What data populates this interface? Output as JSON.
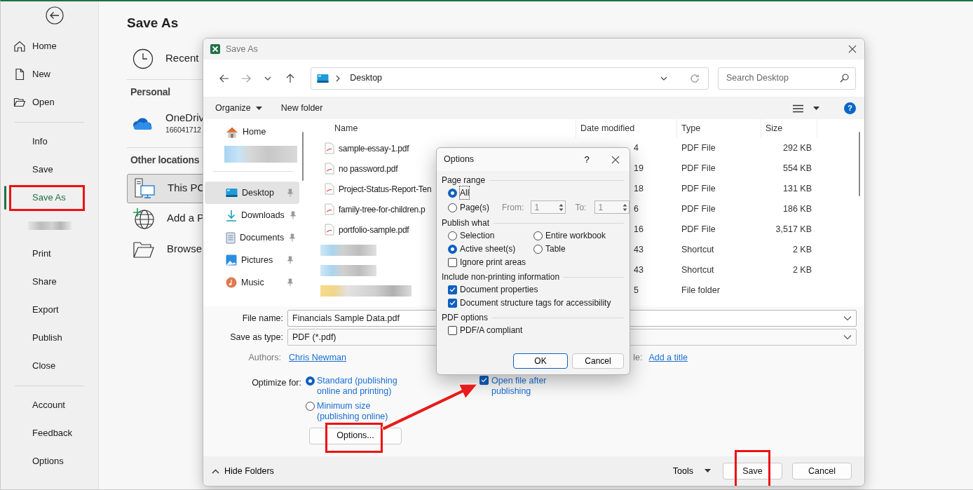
{
  "backstage": {
    "nav_groups": [
      [
        {
          "kind": "item",
          "label": "Home",
          "selected": false,
          "highlighted": false
        },
        {
          "kind": "item",
          "label": "New",
          "selected": false,
          "highlighted": false
        },
        {
          "kind": "item",
          "label": "Open",
          "selected": false,
          "highlighted": false
        }
      ],
      [
        {
          "kind": "item",
          "label": "Info",
          "selected": false,
          "highlighted": false
        },
        {
          "kind": "item",
          "label": "Save",
          "selected": false,
          "highlighted": false
        },
        {
          "kind": "item",
          "label": "Save As",
          "selected": true,
          "highlighted": true
        },
        {
          "kind": "redacted"
        },
        {
          "kind": "item",
          "label": "Print",
          "selected": false,
          "highlighted": false
        },
        {
          "kind": "item",
          "label": "Share",
          "selected": false,
          "highlighted": false
        },
        {
          "kind": "item",
          "label": "Export",
          "selected": false,
          "highlighted": false
        },
        {
          "kind": "item",
          "label": "Publish",
          "selected": false,
          "highlighted": false
        },
        {
          "kind": "item",
          "label": "Close",
          "selected": false,
          "highlighted": false
        }
      ],
      [
        {
          "kind": "item",
          "label": "Account",
          "selected": false,
          "highlighted": false
        },
        {
          "kind": "item",
          "label": "Feedback",
          "selected": false,
          "highlighted": false
        },
        {
          "kind": "item",
          "label": "Options",
          "selected": false,
          "highlighted": false
        }
      ]
    ],
    "title": "Save As",
    "locations": [
      {
        "kind": "item",
        "label": "Recent",
        "selected": false
      },
      {
        "kind": "header",
        "label": "Personal"
      },
      {
        "kind": "item",
        "label": "OneDriv",
        "sublabel": "166041712",
        "selected": false
      },
      {
        "kind": "header",
        "label": "Other locations"
      },
      {
        "kind": "item",
        "label": "This PC",
        "selected": true
      },
      {
        "kind": "item",
        "label": "Add a P",
        "selected": false
      },
      {
        "kind": "item",
        "label": "Browse",
        "selected": false
      }
    ]
  },
  "save_dialog": {
    "title": "Save As",
    "address": "Desktop",
    "search": {
      "placeholder": "Search Desktop"
    },
    "toolbar": {
      "organize": "Organize",
      "new_folder": "New folder",
      "help": "?"
    },
    "nav_pane": [
      {
        "kind": "item",
        "label": "Home",
        "selected": false,
        "pinned": false
      },
      {
        "kind": "redacted"
      },
      {
        "kind": "divider"
      },
      {
        "kind": "item",
        "label": "Desktop",
        "selected": true,
        "pinned": true
      },
      {
        "kind": "item",
        "label": "Downloads",
        "selected": false,
        "pinned": true
      },
      {
        "kind": "item",
        "label": "Documents",
        "selected": false,
        "pinned": true
      },
      {
        "kind": "item",
        "label": "Pictures",
        "selected": false,
        "pinned": true
      },
      {
        "kind": "item",
        "label": "Music",
        "selected": false,
        "pinned": true
      }
    ],
    "columns": [
      "Name",
      "Date modified",
      "Type",
      "Size"
    ],
    "files": [
      {
        "kind": "pdf",
        "name": "sample-essay-1.pdf",
        "date": "4",
        "type": "PDF File",
        "size": "292 KB"
      },
      {
        "kind": "pdf",
        "name": "no password.pdf",
        "date": "19",
        "type": "PDF File",
        "size": "554 KB"
      },
      {
        "kind": "pdf",
        "name": "Project-Status-Report-Ten",
        "date": "18",
        "type": "PDF File",
        "size": "131 KB"
      },
      {
        "kind": "pdf",
        "name": "family-tree-for-children.p",
        "date": "6",
        "type": "PDF File",
        "size": "186 KB"
      },
      {
        "kind": "pdf",
        "name": "portfolio-sample.pdf",
        "date": "16",
        "type": "PDF File",
        "size": "3,517 KB"
      },
      {
        "kind": "redacted",
        "date": "43",
        "type": "Shortcut",
        "size": "2 KB"
      },
      {
        "kind": "redacted",
        "date": "43",
        "type": "Shortcut",
        "size": "2 KB"
      },
      {
        "kind": "redacted_folder",
        "date": "5",
        "type": "File folder"
      }
    ],
    "file_name": {
      "label": "File name:",
      "value": "Financials Sample Data.pdf"
    },
    "save_type": {
      "label": "Save as type:",
      "value": "PDF (*.pdf)"
    },
    "authors": {
      "label": "Authors:",
      "value": "Chris Newman"
    },
    "title_field": {
      "label": "le:",
      "value": "Add a title"
    },
    "optimize": {
      "label": "Optimize for:",
      "choices": [
        {
          "label": "Standard (publishing online and printing)",
          "selected": true
        },
        {
          "label": "Minimum size (publishing online)",
          "selected": false
        }
      ]
    },
    "open_after": {
      "label": "Open file after publishing",
      "checked": true
    },
    "options_button": {
      "label": "Options...",
      "highlighted": true
    },
    "hide_folders": "Hide Folders",
    "tools": "Tools",
    "buttons": [
      {
        "label": "Save",
        "highlighted": true
      },
      {
        "label": "Cancel",
        "highlighted": false
      }
    ]
  },
  "options_dialog": {
    "title": "Options",
    "help": "?",
    "sections": [
      {
        "title": "Page range",
        "items": [
          {
            "kind": "radio",
            "label": "All",
            "selected": true,
            "focused": true
          },
          {
            "kind": "radio_range",
            "label": "Page(s)",
            "selected": false,
            "from_label": "From:",
            "from": "1",
            "to_label": "To:",
            "to": "1"
          }
        ]
      },
      {
        "title": "Publish what",
        "items": [
          {
            "kind": "radio",
            "label": "Selection",
            "selected": false
          },
          {
            "kind": "radio",
            "label": "Entire workbook",
            "selected": false
          },
          {
            "kind": "radio",
            "label": "Active sheet(s)",
            "selected": true
          },
          {
            "kind": "radio",
            "label": "Table",
            "selected": false
          },
          {
            "kind": "checkbox",
            "label": "Ignore print areas",
            "checked": false
          }
        ]
      },
      {
        "title": "Include non-printing information",
        "items": [
          {
            "kind": "checkbox",
            "label": "Document properties",
            "checked": true
          },
          {
            "kind": "checkbox",
            "label": "Document structure tags for accessibility",
            "checked": true
          }
        ]
      },
      {
        "title": "PDF options",
        "items": [
          {
            "kind": "checkbox",
            "label": "PDF/A compliant",
            "checked": false
          }
        ]
      }
    ],
    "buttons": [
      {
        "label": "OK",
        "default": true
      },
      {
        "label": "Cancel",
        "default": false
      }
    ]
  },
  "callout_arrow": true
}
